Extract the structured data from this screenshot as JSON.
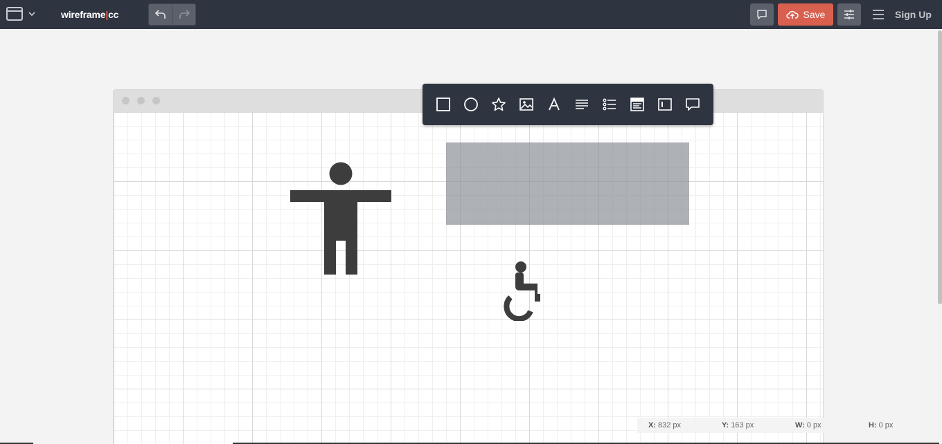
{
  "app": {
    "brand_left": "wireframe",
    "brand_sep": "|",
    "brand_right": "cc"
  },
  "toolbar": {
    "save_label": "Save",
    "signup_label": "Sign Up",
    "accent_color": "#d9604f"
  },
  "icons": {
    "window": "window-icon",
    "undo": "undo-icon",
    "redo": "redo-icon",
    "comment": "comment-icon",
    "upload": "cloud-upload-icon",
    "settings": "sliders-icon",
    "menu": "hamburger-icon"
  },
  "shape_tools": [
    "rectangle",
    "circle",
    "star",
    "image",
    "text",
    "paragraph",
    "list",
    "browser-window",
    "text-input",
    "speech-bubble"
  ],
  "coordinates": {
    "x_label": "X:",
    "x_value": "832 px",
    "y_label": "Y:",
    "y_value": "163 px",
    "w_label": "W:",
    "w_value": "0 px",
    "h_label": "H:",
    "h_value": "0 px"
  }
}
